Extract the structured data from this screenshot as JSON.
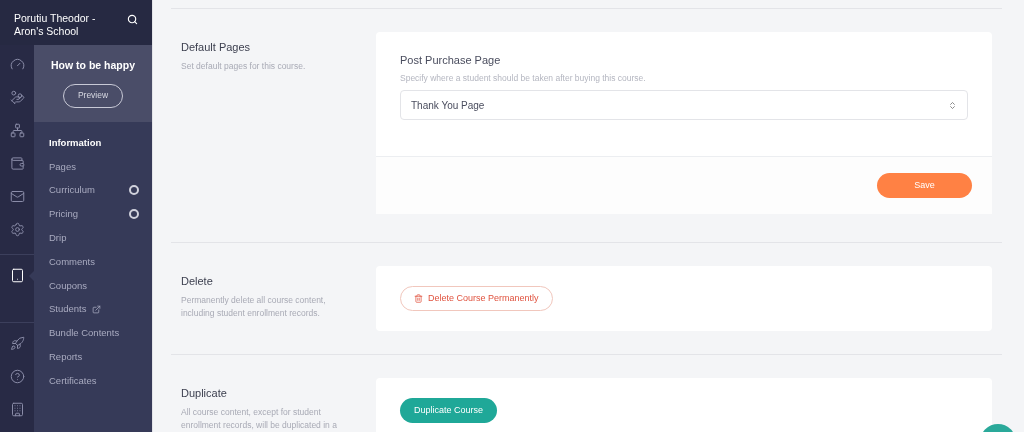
{
  "sidebar": {
    "school": "Porutiu Theodor - Aron's School",
    "rail": [
      {
        "selected": false
      },
      {
        "selected": false
      },
      {
        "selected": false
      },
      {
        "selected": false
      },
      {
        "selected": false
      },
      {
        "selected": false
      },
      {
        "selected": true
      },
      {
        "selected": false
      },
      {
        "selected": false
      },
      {
        "selected": false
      }
    ],
    "course": {
      "title": "How to be happy",
      "preview": "Preview"
    },
    "items": [
      {
        "label": "Information",
        "selected": true,
        "ring": false,
        "external": false
      },
      {
        "label": "Pages",
        "selected": false,
        "ring": false,
        "external": false
      },
      {
        "label": "Curriculum",
        "selected": false,
        "ring": true,
        "external": false
      },
      {
        "label": "Pricing",
        "selected": false,
        "ring": true,
        "external": false
      },
      {
        "label": "Drip",
        "selected": false,
        "ring": false,
        "external": false
      },
      {
        "label": "Comments",
        "selected": false,
        "ring": false,
        "external": false
      },
      {
        "label": "Coupons",
        "selected": false,
        "ring": false,
        "external": false
      },
      {
        "label": "Students",
        "selected": false,
        "ring": false,
        "external": true
      },
      {
        "label": "Bundle Contents",
        "selected": false,
        "ring": false,
        "external": false
      },
      {
        "label": "Reports",
        "selected": false,
        "ring": false,
        "external": false
      },
      {
        "label": "Certificates",
        "selected": false,
        "ring": false,
        "external": false
      }
    ]
  },
  "sections": [
    {
      "kind": "select",
      "title": "Default Pages",
      "description": "Set default pages for this course.",
      "field_label": "Post Purchase Page",
      "field_hint": "Specify where a student should be taken after buying this course.",
      "value": "Thank You Page",
      "button": "Save"
    },
    {
      "kind": "danger",
      "title": "Delete",
      "description": "Permanently delete all course content, including student enrollment records.",
      "button": "Delete Course Permanently"
    },
    {
      "kind": "primary",
      "title": "Duplicate",
      "description": "All course content, except for student enrollment records, will be duplicated in a",
      "button": "Duplicate Course"
    }
  ]
}
